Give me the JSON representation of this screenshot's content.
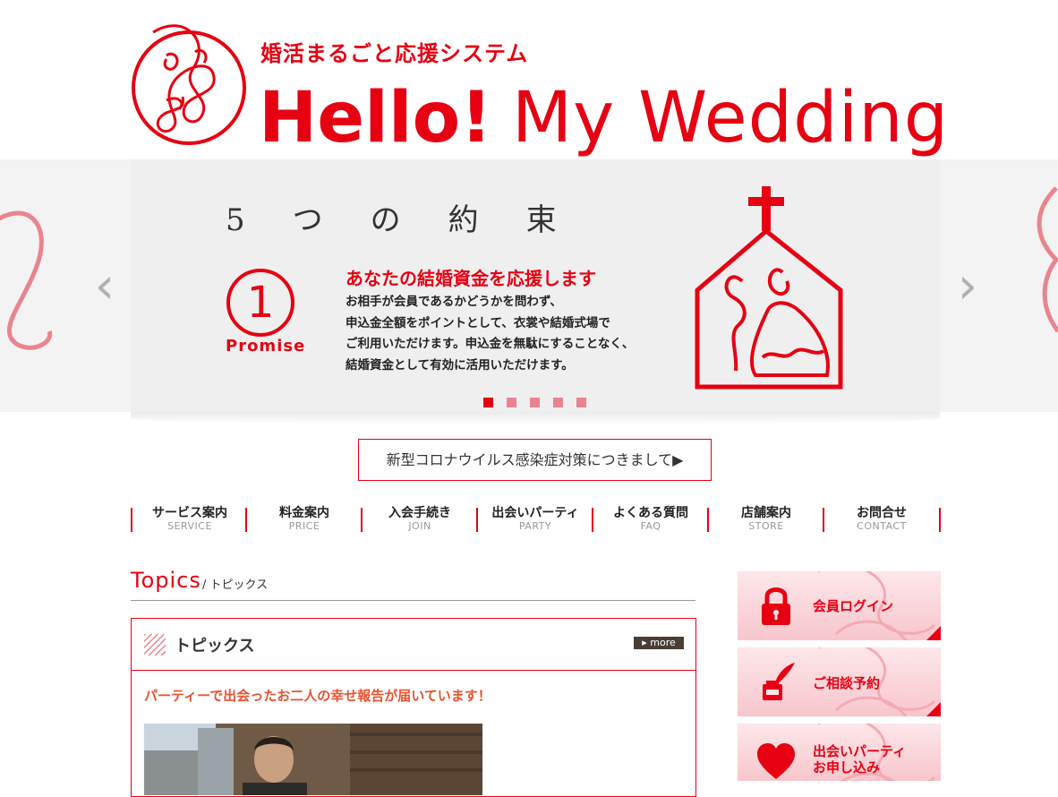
{
  "header": {
    "tagline": "婚活まるごと応援システム",
    "brand_part1": "Hello!",
    "brand_part2": "My Wedding"
  },
  "slider": {
    "title": "5つの約束",
    "promise_number": "1",
    "promise_label": "Promise",
    "heading": "あなたの結婚資金を応援します",
    "body_lines": [
      "お相手が会員であるかどうかを問わず、",
      "申込金全額をポイントとして、衣裳や結婚式場で",
      "ご利用いただけます。申込金を無駄にすることなく、",
      "結婚資金として有効に活用いただけます。"
    ],
    "prev_arrow": "‹",
    "next_arrow": "›",
    "slide_count": 5,
    "active_slide": 1
  },
  "notice": {
    "label": "新型コロナウイルス感染症対策につきまして▶"
  },
  "nav": {
    "items": [
      {
        "ja": "サービス案内",
        "en": "SERVICE"
      },
      {
        "ja": "料金案内",
        "en": "PRICE"
      },
      {
        "ja": "入会手続き",
        "en": "JOIN"
      },
      {
        "ja": "出会いパーティ",
        "en": "PARTY"
      },
      {
        "ja": "よくある質問",
        "en": "FAQ"
      },
      {
        "ja": "店舗案内",
        "en": "STORE"
      },
      {
        "ja": "お問合せ",
        "en": "CONTACT"
      }
    ]
  },
  "topics": {
    "heading_en": "Topics",
    "heading_ja": "/ トピックス",
    "box_title": "トピックス",
    "more_label": "▸ more",
    "article_title": "パーティーで出会ったお二人の幸せ報告が届いています！"
  },
  "sidebar": {
    "login_label": "会員ログイン",
    "consult_label": "ご相談予約",
    "party_label_line1": "出会いパーティ",
    "party_label_line2": "お申し込み"
  },
  "colors": {
    "brand_red": "#e60012",
    "pink": "#e9848f",
    "dark_brown": "#4a3d36"
  }
}
